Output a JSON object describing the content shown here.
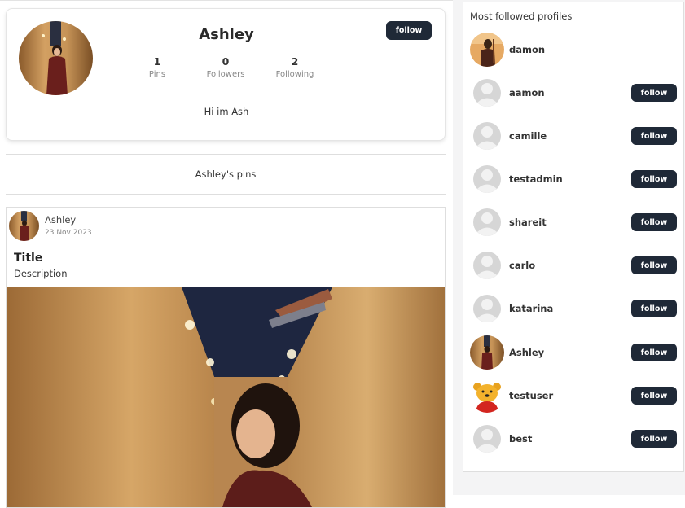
{
  "profile": {
    "name": "Ashley",
    "follow_label": "follow",
    "stats": [
      {
        "value": "1",
        "label": "Pins"
      },
      {
        "value": "0",
        "label": "Followers"
      },
      {
        "value": "2",
        "label": "Following"
      }
    ],
    "bio": "Hi im Ash"
  },
  "pins_header": "Ashley's pins",
  "pin": {
    "author": "Ashley",
    "date": "23 Nov 2023",
    "title": "Title",
    "description": "Description"
  },
  "sidebar": {
    "title": "Most followed profiles",
    "follow_label": "follow",
    "profiles": [
      {
        "name": "damon",
        "avatar": "photo-icon",
        "has_follow": false
      },
      {
        "name": "aamon",
        "avatar": "default-user-icon",
        "has_follow": true
      },
      {
        "name": "camille",
        "avatar": "default-user-icon",
        "has_follow": true
      },
      {
        "name": "testadmin",
        "avatar": "default-user-icon",
        "has_follow": true
      },
      {
        "name": "shareit",
        "avatar": "default-user-icon",
        "has_follow": true
      },
      {
        "name": "carlo",
        "avatar": "default-user-icon",
        "has_follow": true
      },
      {
        "name": "katarina",
        "avatar": "default-user-icon",
        "has_follow": true
      },
      {
        "name": "Ashley",
        "avatar": "photo-icon",
        "has_follow": true
      },
      {
        "name": "testuser",
        "avatar": "cartoon-bear-icon",
        "has_follow": true
      },
      {
        "name": "best",
        "avatar": "default-user-icon",
        "has_follow": true
      }
    ]
  },
  "colors": {
    "button_bg": "#1f2937",
    "button_text": "#ffffff"
  }
}
